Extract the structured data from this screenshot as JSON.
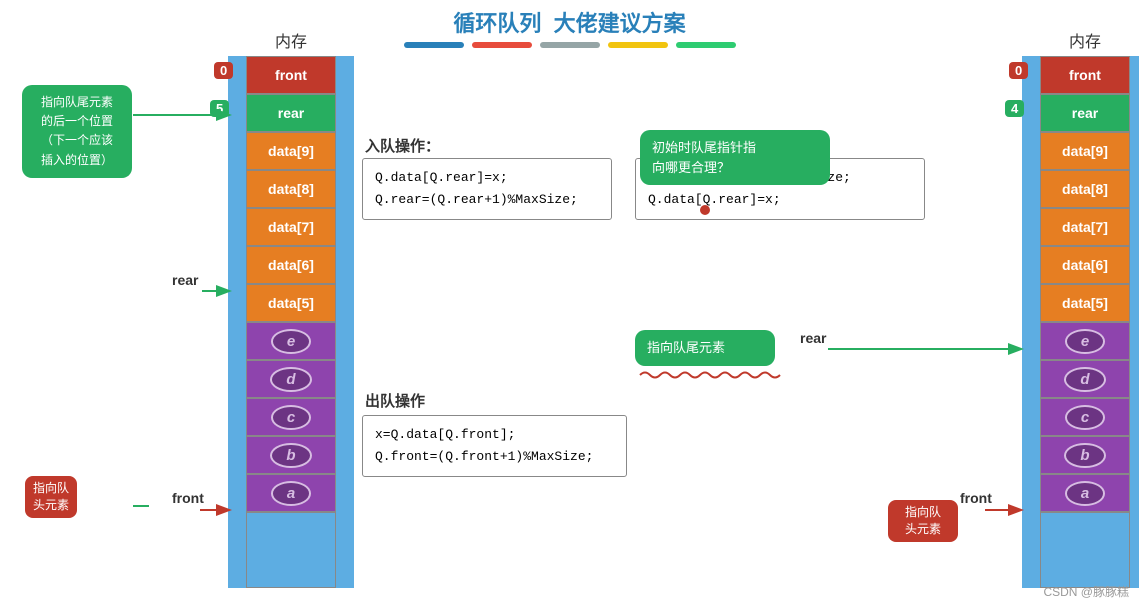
{
  "title": "循环队列",
  "subtitle": "大佬建议方案",
  "colorBar": [
    "#2980b9",
    "#e74c3c",
    "#95a5a6",
    "#f1c40f",
    "#2ecc71"
  ],
  "leftMemory": {
    "label": "内存",
    "indexTop": "0",
    "indexRear": "5",
    "cells": [
      {
        "type": "front",
        "text": "front"
      },
      {
        "type": "rear",
        "text": "rear"
      },
      {
        "type": "data",
        "text": "data[9]"
      },
      {
        "type": "data",
        "text": "data[8]"
      },
      {
        "type": "data",
        "text": "data[7]"
      },
      {
        "type": "data",
        "text": "data[6]"
      },
      {
        "type": "data",
        "text": "data[5]"
      },
      {
        "type": "purple",
        "text": "e"
      },
      {
        "type": "purple",
        "text": "d"
      },
      {
        "type": "purple",
        "text": "c"
      },
      {
        "type": "purple",
        "text": "b"
      },
      {
        "type": "purple",
        "text": "a"
      }
    ]
  },
  "rightMemory": {
    "label": "内存",
    "indexTop": "0",
    "indexRear": "4",
    "cells": [
      {
        "type": "front",
        "text": "front"
      },
      {
        "type": "rear",
        "text": "rear"
      },
      {
        "type": "data",
        "text": "data[9]"
      },
      {
        "type": "data",
        "text": "data[8]"
      },
      {
        "type": "data",
        "text": "data[7]"
      },
      {
        "type": "data",
        "text": "data[6]"
      },
      {
        "type": "data",
        "text": "data[5]"
      },
      {
        "type": "purple",
        "text": "e"
      },
      {
        "type": "purple",
        "text": "d"
      },
      {
        "type": "purple",
        "text": "c"
      },
      {
        "type": "purple",
        "text": "b"
      },
      {
        "type": "purple",
        "text": "a"
      }
    ]
  },
  "leftCallout": {
    "text": "指向队尾元素\n的后一个位置\n（下一个应该\n插入的位置）"
  },
  "rearLabelLeft": "rear",
  "frontLabelLeft": "front",
  "rearLabelRight": "rear",
  "frontLabelRight": "front",
  "enqueueOp": "入队操作：",
  "dequeueOp": "出队操作",
  "code1": "Q.data[Q.rear]=x;\nQ.rear=(Q.rear+1)%MaxSize;",
  "code2": "Q.rear=(Q.rear+1)%MaxSize;\nQ.data[Q.rear]=x;",
  "code3": "x=Q.data[Q.front];\nQ.front=(Q.front+1)%MaxSize;",
  "bubble1": "初始时队尾指针指\n向哪更合理？",
  "bubble2": "指向队尾元素",
  "leftBadge1": "指向队\n头元素",
  "rightBadge1": "指向队\n头元素",
  "watermark": "CSDN @豚豚糕"
}
